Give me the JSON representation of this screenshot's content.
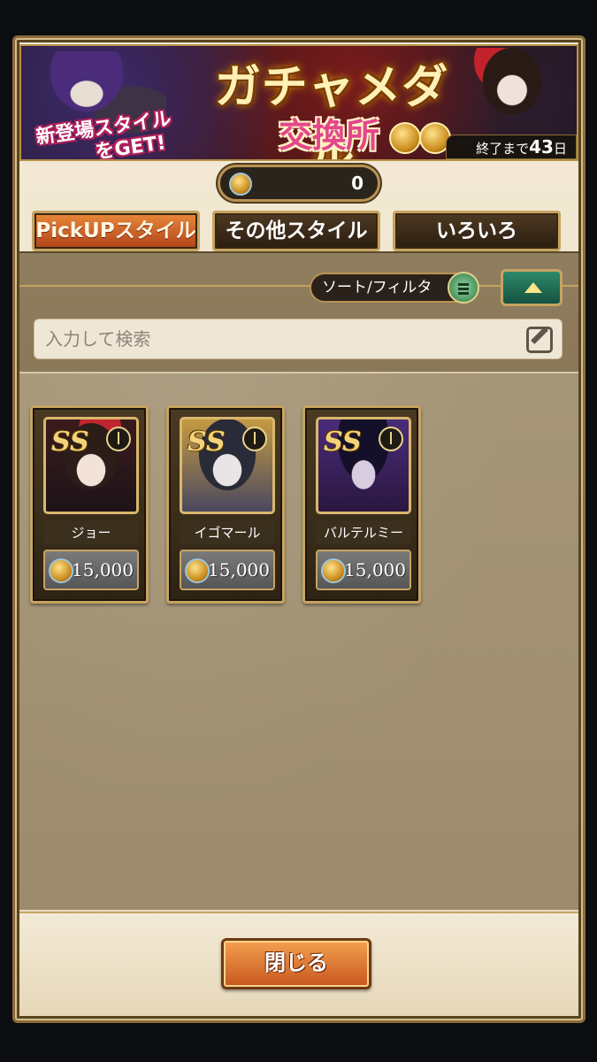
{
  "banner": {
    "title": "ガチャメダル",
    "subtitle": "交換所",
    "promo_line1": "新登場スタイル",
    "promo_line2": "をGET!",
    "days_prefix": "終了まで",
    "days_value": "43",
    "days_suffix": "日"
  },
  "medal_counter": {
    "icon": "gacha-medal-icon",
    "value": "0"
  },
  "tabs": [
    {
      "label": "PickUPスタイル",
      "active": true
    },
    {
      "label": "その他スタイル",
      "active": false
    },
    {
      "label": "いろいろ",
      "active": false
    }
  ],
  "filter": {
    "sort_label": "ソート/フィルタ",
    "search_placeholder": "入力して検索"
  },
  "items": [
    {
      "name": "ジョー",
      "rank": "SS",
      "price": "15,000"
    },
    {
      "name": "イゴマール",
      "rank": "SS",
      "price": "15,000"
    },
    {
      "name": "バルテルミー",
      "rank": "SS",
      "price": "15,000"
    }
  ],
  "footer": {
    "close_label": "閉じる"
  },
  "colors": {
    "accent_orange": "#d8662a",
    "frame_gold": "#c6a461",
    "panel_bg": "#a8987a"
  }
}
